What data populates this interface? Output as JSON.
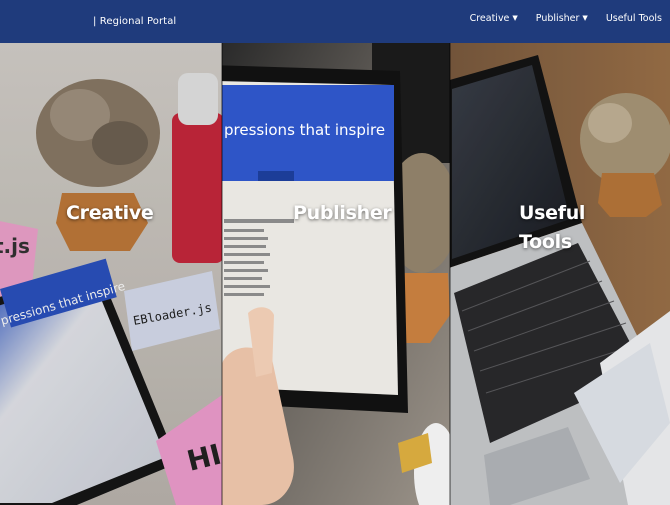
{
  "header": {
    "brand": "| Regional Portal",
    "nav": [
      {
        "label": "Creative",
        "dropdown": true
      },
      {
        "label": "Publisher",
        "dropdown": true
      },
      {
        "label": "Useful Tools",
        "dropdown": false
      }
    ]
  },
  "panels": [
    {
      "title": "Creative"
    },
    {
      "title": "Publisher"
    },
    {
      "title": "Useful Tools"
    }
  ],
  "colors": {
    "nav_bg": "#1f3b7c",
    "text": "#ffffff"
  },
  "icons": {
    "caret": "chevron-down-icon"
  }
}
